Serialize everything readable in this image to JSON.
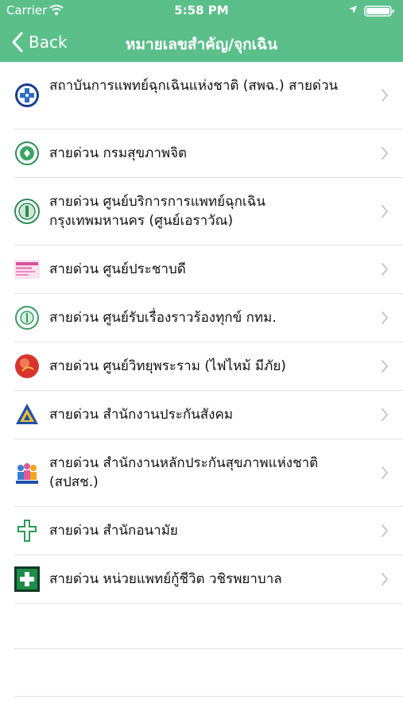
{
  "status_bar": {
    "carrier": "Carrier",
    "time": "5:58 PM"
  },
  "nav": {
    "back_label": "Back",
    "title": "หมายเลขสำคัญ/จุกเฉิน"
  },
  "items": [
    {
      "label": "สถาบันการแพทย์ฉุกเฉินแห่งชาติ (สพฉ.) สายด่วน",
      "icon": "niem-logo-icon"
    },
    {
      "label": "สายด่วน กรมสุขภาพจิต",
      "icon": "mental-health-logo-icon"
    },
    {
      "label": "สายด่วน ศูนย์บริการการแพทย์ฉุกเฉิน กรุงเทพมหานคร (ศูนย์เอราวัณ)",
      "icon": "erawan-logo-icon"
    },
    {
      "label": "สายด่วน ศูนย์ประชาบดี",
      "icon": "prachabodi-logo-icon"
    },
    {
      "label": "สายด่วน ศูนย์รับเรื่องราวร้องทุกข์ กทม.",
      "icon": "bma-logo-icon"
    },
    {
      "label": "สายด่วน ศูนย์วิทยุพระราม (ไฟไหม้ มีภัย)",
      "icon": "rama-radio-logo-icon"
    },
    {
      "label": "สายด่วน สำนักงานประกันสังคม",
      "icon": "sso-logo-icon"
    },
    {
      "label": "สายด่วน สำนักงานหลักประกันสุขภาพแห่งชาติ (สปสช.)",
      "icon": "nhso-logo-icon"
    },
    {
      "label": "สายด่วน สำนักอนามัย",
      "icon": "health-bureau-logo-icon"
    },
    {
      "label": "สายด่วน หน่วยแพทย์กู้ชีวิต วชิรพยาบาล",
      "icon": "vajira-rescue-logo-icon"
    }
  ]
}
